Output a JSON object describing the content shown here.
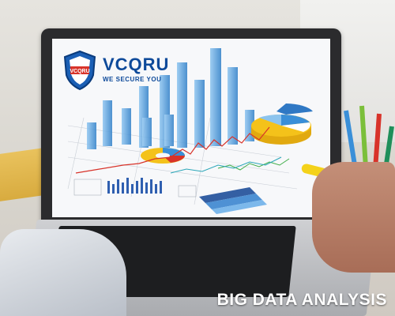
{
  "brand": {
    "name": "VCQRU",
    "tagline": "WE SECURE YOU",
    "shield_text": "VCQRU"
  },
  "caption": "BIG DATA ANALYSIS",
  "colors": {
    "brand_blue": "#0e4a9a",
    "bar_blue": "#5aa8e6",
    "pie_yellow": "#f4c21a",
    "pie_blue": "#3a8fd8",
    "line_red": "#d8332a",
    "highlighter": "#f4d21a"
  }
}
